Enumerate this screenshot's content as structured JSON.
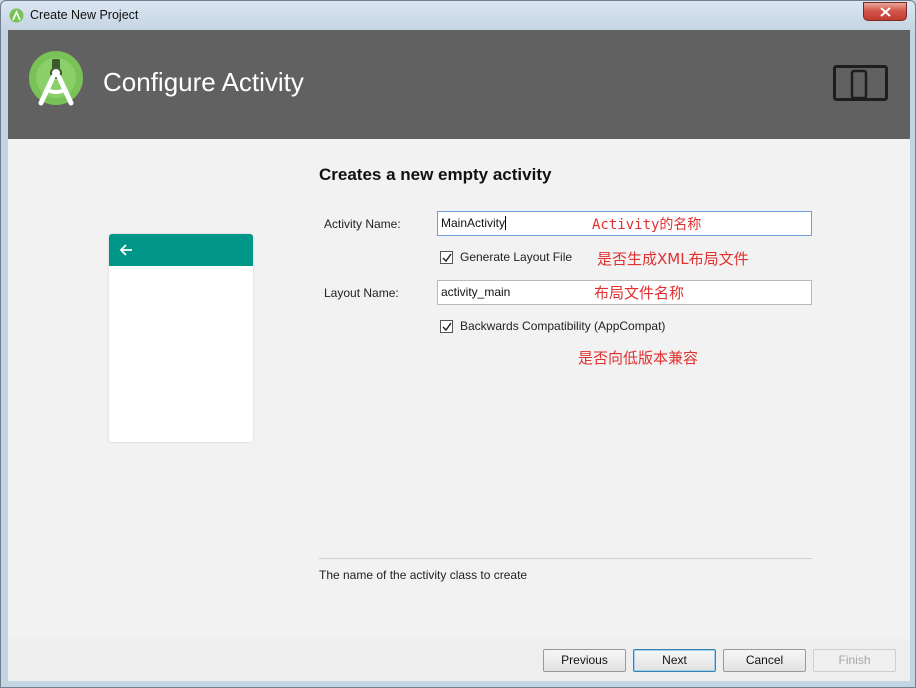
{
  "window": {
    "title": "Create New Project"
  },
  "header": {
    "title": "Configure Activity",
    "logo_icon": "android-studio-logo-icon",
    "device_icon": "phone-tablet-icon",
    "background": "#616161"
  },
  "form": {
    "section_title": "Creates a new empty activity",
    "activity_name_label": "Activity Name:",
    "activity_name_value": "MainActivity",
    "generate_layout_label": "Generate Layout File",
    "generate_layout_checked": true,
    "layout_name_label": "Layout Name:",
    "layout_name_value": "activity_main",
    "backwards_compat_label": "Backwards Compatibility (AppCompat)",
    "backwards_compat_checked": true
  },
  "annotations": {
    "activity_name_note": "Activity的名称",
    "generate_layout_note": "是否生成XML布局文件",
    "layout_name_note": "布局文件名称",
    "backwards_compat_note": "是否向低版本兼容",
    "color": "#e03030"
  },
  "preview": {
    "toolbar_color": "#009688",
    "back_icon": "arrow-left-icon"
  },
  "hint": {
    "text": "The name of the activity class to create"
  },
  "footer": {
    "previous_label": "Previous",
    "next_label": "Next",
    "cancel_label": "Cancel",
    "finish_label": "Finish",
    "finish_enabled": false
  }
}
